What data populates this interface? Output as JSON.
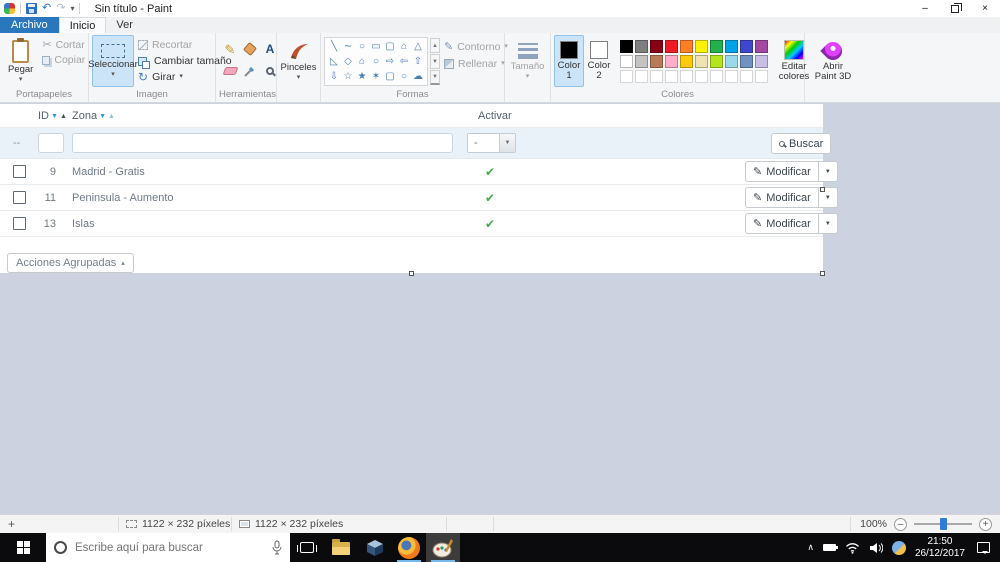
{
  "titlebar": {
    "title": "Sin título - Paint"
  },
  "icons": {
    "caret_down": "▾",
    "caret_up": "▴",
    "sort_down": "▼",
    "sort_up": "▲",
    "check": "✔",
    "pencil": "✎",
    "scissors": "✂",
    "undo": "↶",
    "redo": "↷",
    "rotate": "↻",
    "minimize": "–",
    "close": "×",
    "text_tool": "A",
    "status_plus": "+",
    "tray_chevron": "∧",
    "scroll_up": "▲",
    "scroll_down": "▼",
    "scroll_more": "▼"
  },
  "tabs": {
    "file": "Archivo",
    "home": "Inicio",
    "view": "Ver"
  },
  "ribbon": {
    "clipboard": {
      "group": "Portapapeles",
      "paste": "Pegar",
      "cut": "Cortar",
      "copy": "Copiar"
    },
    "image": {
      "group": "Imagen",
      "select": "Seleccionar",
      "crop": "Recortar",
      "resize": "Cambiar tamaño",
      "rotate": "Girar"
    },
    "tools": {
      "group": "Herramientas"
    },
    "brushes": {
      "label": "Pinceles"
    },
    "shapes": {
      "group": "Formas",
      "outline": "Contorno",
      "fill": "Rellenar",
      "glyphs": [
        "╲",
        "∼",
        "○",
        "▭",
        "▢",
        "⌂",
        "△",
        "◺",
        "◇",
        "⌂",
        "○",
        "⇨",
        "⇦",
        "⇧",
        "⇩",
        "☆",
        "★",
        "✶",
        "▢",
        "○",
        "☁"
      ]
    },
    "size": {
      "label": "Tamaño"
    },
    "colors": {
      "group": "Colores",
      "color1": "Color 1",
      "color2": "Color 2",
      "edit": "Editar colores",
      "palette_row1": [
        "#000000",
        "#7f7f7f",
        "#880015",
        "#ed1c24",
        "#ff7f27",
        "#fff200",
        "#22b14c",
        "#00a2e8",
        "#3f48cc",
        "#a349a4"
      ],
      "palette_row2": [
        "#ffffff",
        "#c3c3c3",
        "#b97a57",
        "#ffaec9",
        "#ffc90e",
        "#efe4b0",
        "#b5e61d",
        "#99d9ea",
        "#7092be",
        "#c8bfe7"
      ],
      "empty_cells": 10
    },
    "paint3d": {
      "label": "Abrir Paint 3D"
    }
  },
  "canvas": {
    "headers": {
      "id": "ID",
      "zona": "Zona",
      "activar": "Activar"
    },
    "filter": {
      "dash": "--",
      "select_value": "-",
      "search": "Buscar"
    },
    "rows": [
      {
        "id": "9",
        "zona": "Madrid - Gratis",
        "action": "Modificar"
      },
      {
        "id": "11",
        "zona": "Peninsula - Aumento",
        "action": "Modificar"
      },
      {
        "id": "13",
        "zona": "Islas",
        "action": "Modificar"
      }
    ],
    "group_actions": "Acciones Agrupadas"
  },
  "statusbar": {
    "selection_size": "1122 × 232 píxeles",
    "image_size": "1122 × 232 píxeles",
    "zoom_level": "100%",
    "zoom_out": "–",
    "zoom_in": "+"
  },
  "taskbar": {
    "search_placeholder": "Escribe aquí para buscar",
    "time": "21:50",
    "date": "26/12/2017"
  },
  "colors": {
    "accent_blue": "#2b77bd",
    "selection_highlight": "#cce4f7",
    "workspace_bg": "#ccd2e0",
    "check_green": "#3fae49",
    "taskbar_underline": "#76b9ed"
  }
}
